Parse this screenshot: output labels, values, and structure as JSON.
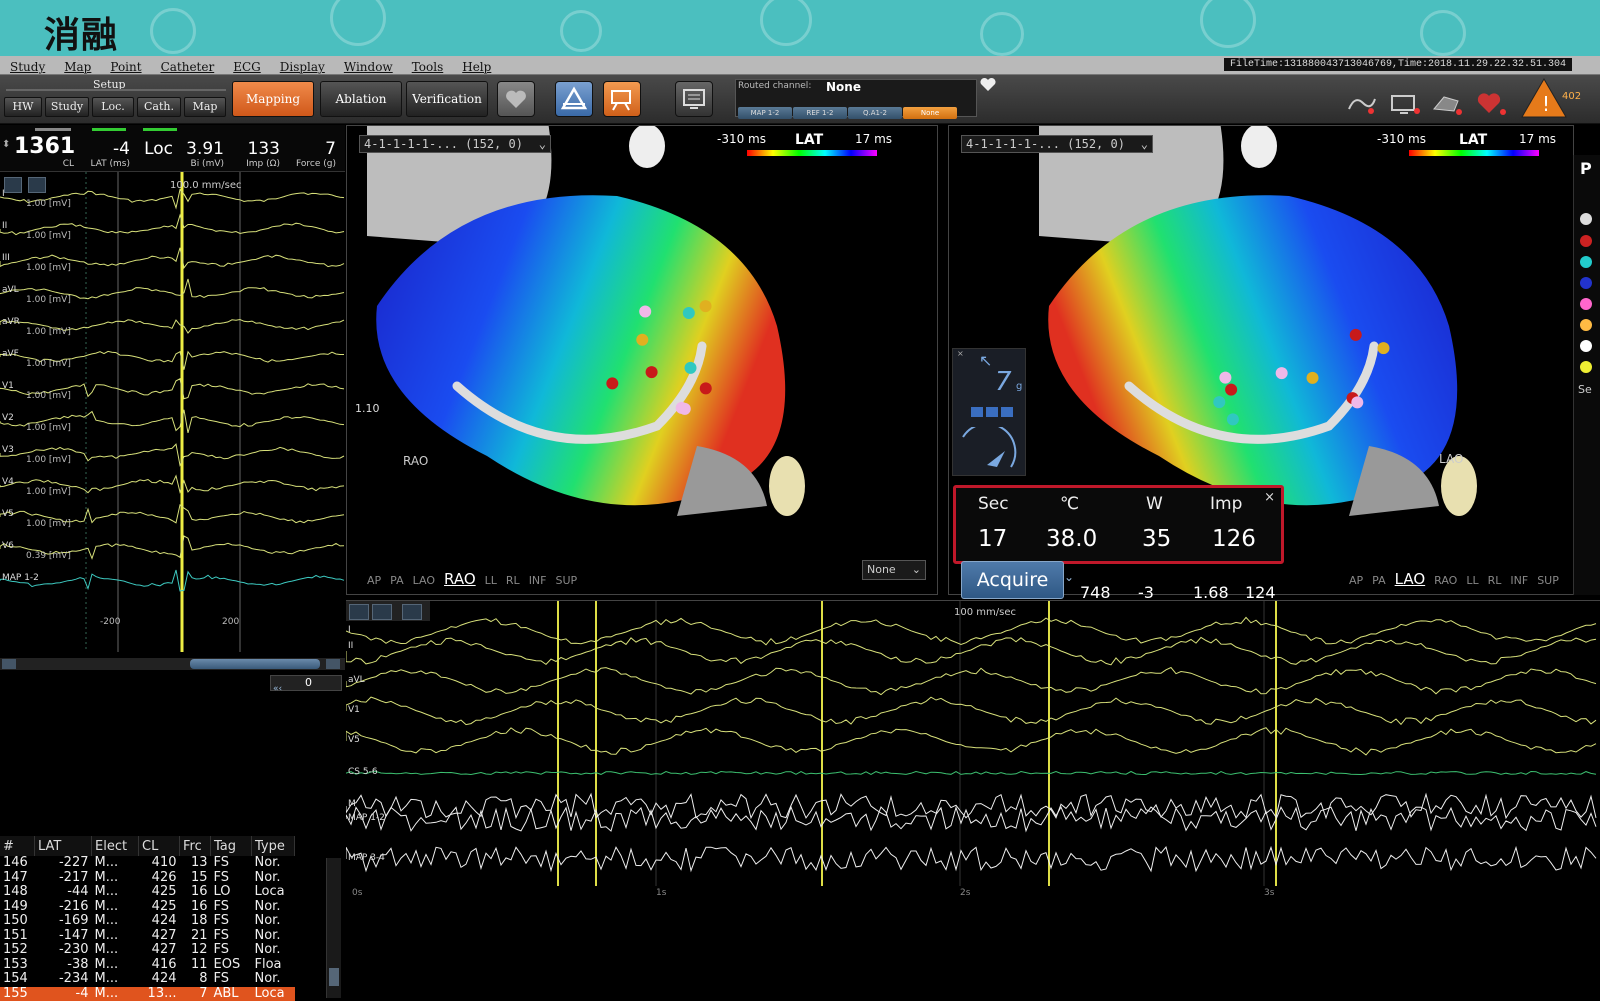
{
  "banner": {
    "title": "消融"
  },
  "menu": [
    "Study",
    "Map",
    "Point",
    "Catheter",
    "ECG",
    "Display",
    "Window",
    "Tools",
    "Help"
  ],
  "filetime": "FileTime:131880043713046769,Time:2018.11.29.22.32.51.304",
  "setup": {
    "label": "Setup",
    "buttons": [
      "HW",
      "Study",
      "Loc.",
      "Cath.",
      "Map"
    ]
  },
  "modes": {
    "mapping": "Mapping",
    "ablation": "Ablation",
    "verification": "Verification"
  },
  "routed": {
    "label": "Routed channel:",
    "value": "None",
    "chips": [
      "MAP 1-2",
      "REF 1-2",
      "Q.A1-2",
      "None"
    ]
  },
  "alert_count": "402",
  "readout": {
    "cl": {
      "value": "1361",
      "label": "CL"
    },
    "lat": {
      "value": "-4",
      "label": "LAT (ms)"
    },
    "loc": {
      "value": "Loc"
    },
    "bi": {
      "value": "3.91",
      "label": "Bi (mV)"
    },
    "imp": {
      "value": "133",
      "label": "Imp (Ω)"
    },
    "force": {
      "value": "7",
      "label": "Force (g)"
    }
  },
  "left_egm": {
    "speed": "100.0 mm/sec",
    "leads": [
      {
        "name": "I",
        "scale": "1.00 [mV]"
      },
      {
        "name": "II",
        "scale": "1.00 [mV]"
      },
      {
        "name": "III",
        "scale": "1.00 [mV]"
      },
      {
        "name": "aVL",
        "scale": "1.00 [mV]"
      },
      {
        "name": "aVR",
        "scale": "1.00 [mV]"
      },
      {
        "name": "aVF",
        "scale": "1.00 [mV]"
      },
      {
        "name": "V1",
        "scale": "1.00 [mV]"
      },
      {
        "name": "V2",
        "scale": "1.00 [mV]"
      },
      {
        "name": "V3",
        "scale": "1.00 [mV]"
      },
      {
        "name": "V4",
        "scale": "1.00 [mV]"
      },
      {
        "name": "V5",
        "scale": "1.00 [mV]"
      },
      {
        "name": "V6",
        "scale": "0.39 [mV]"
      },
      {
        "name": "MAP 1-2",
        "scale": ""
      }
    ],
    "ticks": [
      "-200",
      "200"
    ],
    "counter": "0"
  },
  "points_table": {
    "headers": [
      "#",
      "LAT",
      "Elect",
      "CL",
      "Frc",
      "Tag",
      "Type"
    ],
    "rows": [
      [
        "146",
        "-227",
        "M...",
        "410",
        "13",
        "FS",
        "Nor."
      ],
      [
        "147",
        "-217",
        "M...",
        "426",
        "15",
        "FS",
        "Nor."
      ],
      [
        "148",
        "-44",
        "M...",
        "425",
        "16",
        "LO",
        "Loca"
      ],
      [
        "149",
        "-216",
        "M...",
        "425",
        "16",
        "FS",
        "Nor."
      ],
      [
        "150",
        "-169",
        "M...",
        "424",
        "18",
        "FS",
        "Nor."
      ],
      [
        "151",
        "-147",
        "M...",
        "427",
        "21",
        "FS",
        "Nor."
      ],
      [
        "152",
        "-230",
        "M...",
        "427",
        "12",
        "FS",
        "Nor."
      ],
      [
        "153",
        "-38",
        "M...",
        "416",
        "11",
        "EOS",
        "Floa"
      ],
      [
        "154",
        "-234",
        "M...",
        "424",
        "8",
        "FS",
        "Nor."
      ],
      [
        "155",
        "-4",
        "M...",
        "13...",
        "7",
        "ABL",
        "Loca"
      ]
    ]
  },
  "map_left": {
    "selector": "4-1-1-1-1-... (152, 0)",
    "lat_min": "-310 ms",
    "lat_title": "LAT",
    "lat_max": "17 ms",
    "scale_value": "1.10",
    "orientation": "RAO",
    "views": [
      "AP",
      "PA",
      "LAO",
      "RAO",
      "LL",
      "RL",
      "INF",
      "SUP"
    ],
    "active_view": "RAO",
    "dropdown": "None"
  },
  "map_right": {
    "selector": "4-1-1-1-1-... (152, 0)",
    "lat_min": "-310 ms",
    "lat_title": "LAT",
    "lat_max": "17 ms",
    "orientation": "LAO",
    "views": [
      "AP",
      "PA",
      "LAO",
      "RAO",
      "LL",
      "RL",
      "INF",
      "SUP"
    ],
    "active_view": "LAO",
    "force_value": "7",
    "force_unit": "g"
  },
  "ablation": {
    "headers": [
      "Sec",
      "℃",
      "W",
      "Imp"
    ],
    "values": [
      "17",
      "38.0",
      "35",
      "126"
    ]
  },
  "acquire": {
    "label": "Acquire"
  },
  "bottom_stats": [
    "748",
    "-3",
    "1.68",
    "124"
  ],
  "bottom_egm": {
    "speed": "100 mm/sec",
    "leads": [
      "I",
      "II",
      "aVL",
      "V1",
      "V5",
      "CS 5-6",
      "M",
      "MAP 1-2",
      "MAP 3-4"
    ],
    "time_ticks": [
      "0s",
      "1s",
      "2s",
      "3s"
    ]
  },
  "right_strip": {
    "label1": "P",
    "label2": "Se"
  }
}
